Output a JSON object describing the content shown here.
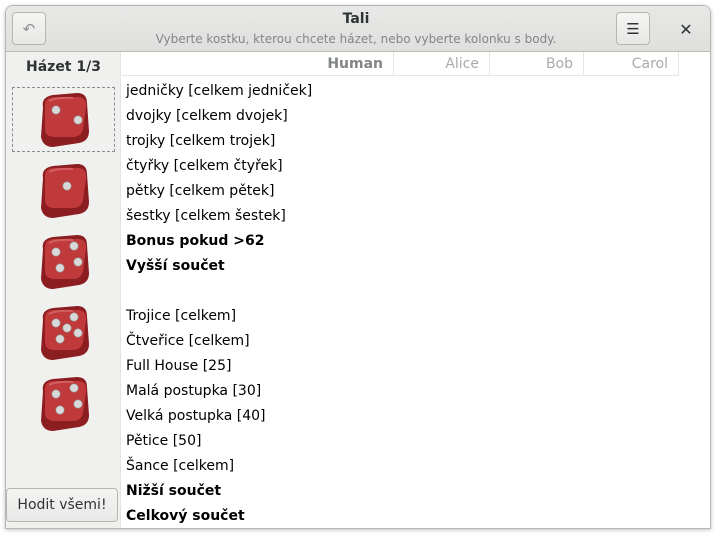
{
  "window": {
    "title": "Tali",
    "subtitle": "Vyberte kostku, kterou chcete házet, nebo vyberte kolonku s body."
  },
  "sidebar": {
    "roll_label": "Házet 1/3",
    "dice": [
      {
        "value": 2,
        "focused": true
      },
      {
        "value": 1,
        "focused": false
      },
      {
        "value": 4,
        "focused": false
      },
      {
        "value": 5,
        "focused": false
      },
      {
        "value": 4,
        "focused": false
      }
    ],
    "roll_all_label": "Hodit všemi!"
  },
  "players": [
    "Human",
    "Alice",
    "Bob",
    "Carol"
  ],
  "rows": [
    {
      "label": "jedničky [celkem jedniček]",
      "bold": false
    },
    {
      "label": "dvojky [celkem dvojek]",
      "bold": false
    },
    {
      "label": "trojky [celkem trojek]",
      "bold": false
    },
    {
      "label": "čtyřky [celkem čtyřek]",
      "bold": false
    },
    {
      "label": "pětky [celkem pětek]",
      "bold": false
    },
    {
      "label": "šestky [celkem šestek]",
      "bold": false
    },
    {
      "label": "Bonus pokud >62",
      "bold": true
    },
    {
      "label": "Vyšší součet",
      "bold": true
    },
    {
      "label": "",
      "bold": false
    },
    {
      "label": "Trojice [celkem]",
      "bold": false
    },
    {
      "label": "Čtveřice [celkem]",
      "bold": false
    },
    {
      "label": "Full House [25]",
      "bold": false
    },
    {
      "label": "Malá postupka [30]",
      "bold": false
    },
    {
      "label": "Velká postupka [40]",
      "bold": false
    },
    {
      "label": "Pětice [50]",
      "bold": false
    },
    {
      "label": "Šance [celkem]",
      "bold": false
    },
    {
      "label": "Nižší součet",
      "bold": true
    },
    {
      "label": "Celkový součet",
      "bold": true
    }
  ],
  "colors": {
    "die_red": "#c0393b",
    "die_dark": "#8c1d20",
    "pip": "#d8d8d8"
  }
}
